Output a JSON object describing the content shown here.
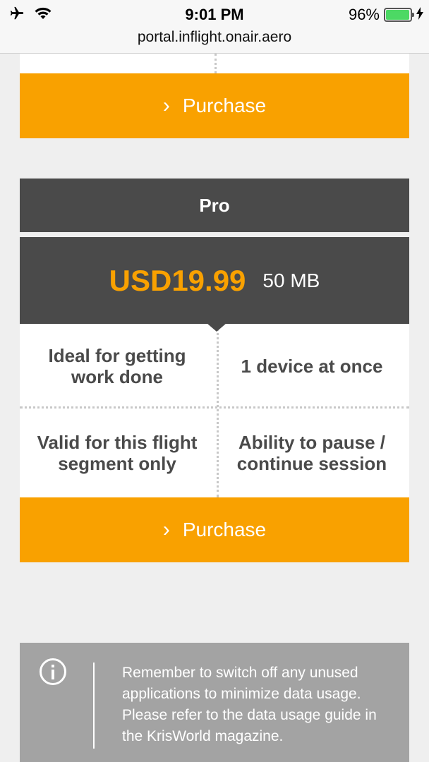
{
  "status_bar": {
    "time": "9:01 PM",
    "battery_percent_text": "96%",
    "battery_level": 0.96,
    "icons": [
      "airplane-icon",
      "wifi-icon",
      "battery-icon",
      "charging-bolt-icon"
    ]
  },
  "browser": {
    "url": "portal.inflight.onair.aero"
  },
  "plans": [
    {
      "purchase_label": "Purchase"
    },
    {
      "name": "Pro",
      "price": "USD19.99",
      "data": "50 MB",
      "features": [
        "Ideal for getting work done",
        "1 device at once",
        "Valid for this flight segment only",
        "Ability to pause / continue session"
      ],
      "purchase_label": "Purchase"
    }
  ],
  "info": {
    "icon": "info-icon",
    "message": "Remember to switch off any unused applications to minimize data usage. Please refer to the data usage guide in the KrisWorld magazine."
  },
  "colors": {
    "accent": "#f9a100",
    "dark": "#4a4a4a",
    "info_bg": "#a3a3a3"
  }
}
